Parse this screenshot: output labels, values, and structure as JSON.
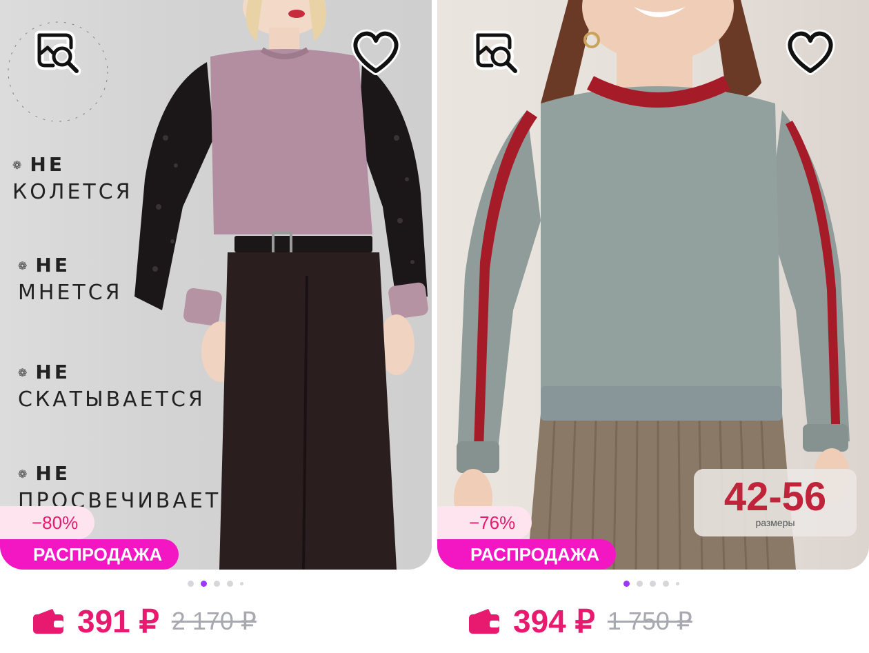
{
  "products": [
    {
      "features": [
        {
          "ne": "НЕ",
          "word": "КОЛЕТСЯ"
        },
        {
          "ne": "НЕ",
          "word": "МНЕТСЯ"
        },
        {
          "ne": "НЕ",
          "word": "СКАТЫВАЕТСЯ"
        },
        {
          "ne": "НЕ",
          "word": "ПРОСВЕЧИВАЕТ"
        }
      ],
      "discount": "−80%",
      "sale_label": "РАСПРОДАЖА",
      "price": "391 ₽",
      "old_price": "2 170 ₽",
      "image_index": 2,
      "image_count": 5
    },
    {
      "size_range": "42-56",
      "size_label": "размеры",
      "discount": "−76%",
      "sale_label": "РАСПРОДАЖА",
      "price": "394 ₽",
      "old_price": "1 750 ₽",
      "image_index": 1,
      "image_count": 5
    }
  ],
  "colors": {
    "accent_pink": "#e81a6f",
    "sale_magenta": "#f316c3",
    "dot_active": "#9b37ff"
  },
  "icons": [
    "image-search-icon",
    "heart-icon",
    "wallet-icon"
  ]
}
